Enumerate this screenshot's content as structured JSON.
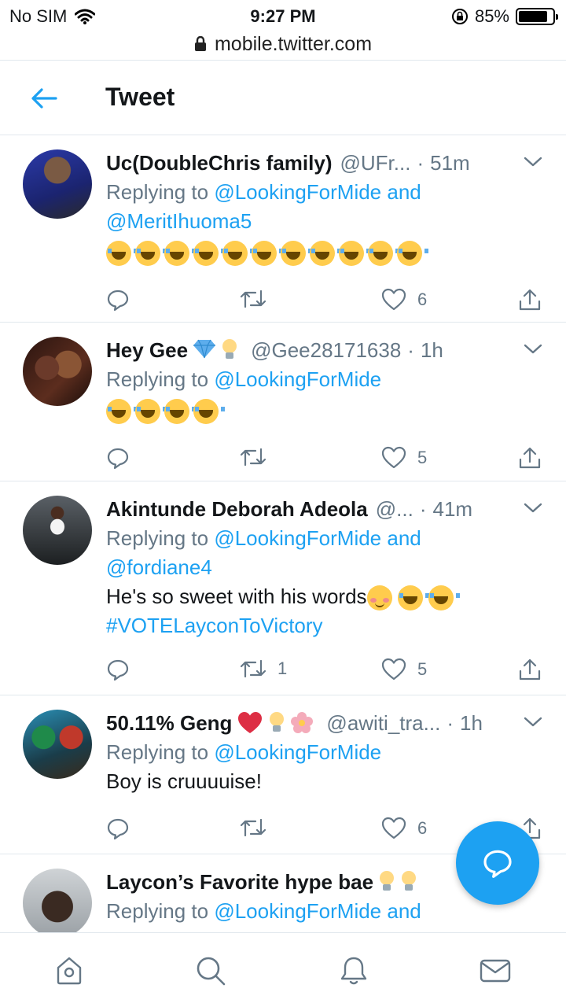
{
  "status_bar": {
    "carrier": "No SIM",
    "time": "9:27 PM",
    "battery": "85%",
    "battery_level": 0.85
  },
  "browser": {
    "url": "mobile.twitter.com"
  },
  "header": {
    "title": "Tweet",
    "back_icon": "arrow-left-icon"
  },
  "colors": {
    "accent": "#1da1f2",
    "text": "#14171a",
    "muted": "#657786",
    "like": "#657786"
  },
  "tweets": [
    {
      "name": "Uc(DoubleChris family)",
      "handle": "@UFr...",
      "time": "51m",
      "reply_prefix": "Replying to",
      "reply_to": "@LookingForMide and",
      "reply_to_2": "@MeritIhuoma5",
      "replies": "",
      "retweets": "",
      "likes": "6"
    },
    {
      "name": "Hey Gee",
      "handle": "@Gee28171638",
      "time": "1h",
      "reply_prefix": "Replying to",
      "reply_to": "@LookingForMide",
      "replies": "",
      "retweets": "",
      "likes": "5"
    },
    {
      "name": "Akintunde Deborah Adeola",
      "handle": "@...",
      "time": "41m",
      "reply_prefix": "Replying to",
      "reply_to": "@LookingForMide and",
      "reply_to_2": "@fordiane4",
      "text": "He's so sweet with his words",
      "hashtag": "#VOTELayconToVictory",
      "replies": "",
      "retweets": "1",
      "likes": "5"
    },
    {
      "name": "50.11% Geng",
      "handle": "@awiti_tra...",
      "time": "1h",
      "reply_prefix": "Replying to",
      "reply_to": "@LookingForMide",
      "text": "Boy is cruuuuise!",
      "replies": "",
      "retweets": "",
      "likes": "6"
    },
    {
      "name": "Laycon’s Favorite hype bae",
      "reply_prefix": "Replying to",
      "reply_to": "@LookingForMide and"
    }
  ],
  "bottom_nav": [
    "home-icon",
    "search-icon",
    "notifications-icon",
    "messages-icon"
  ]
}
